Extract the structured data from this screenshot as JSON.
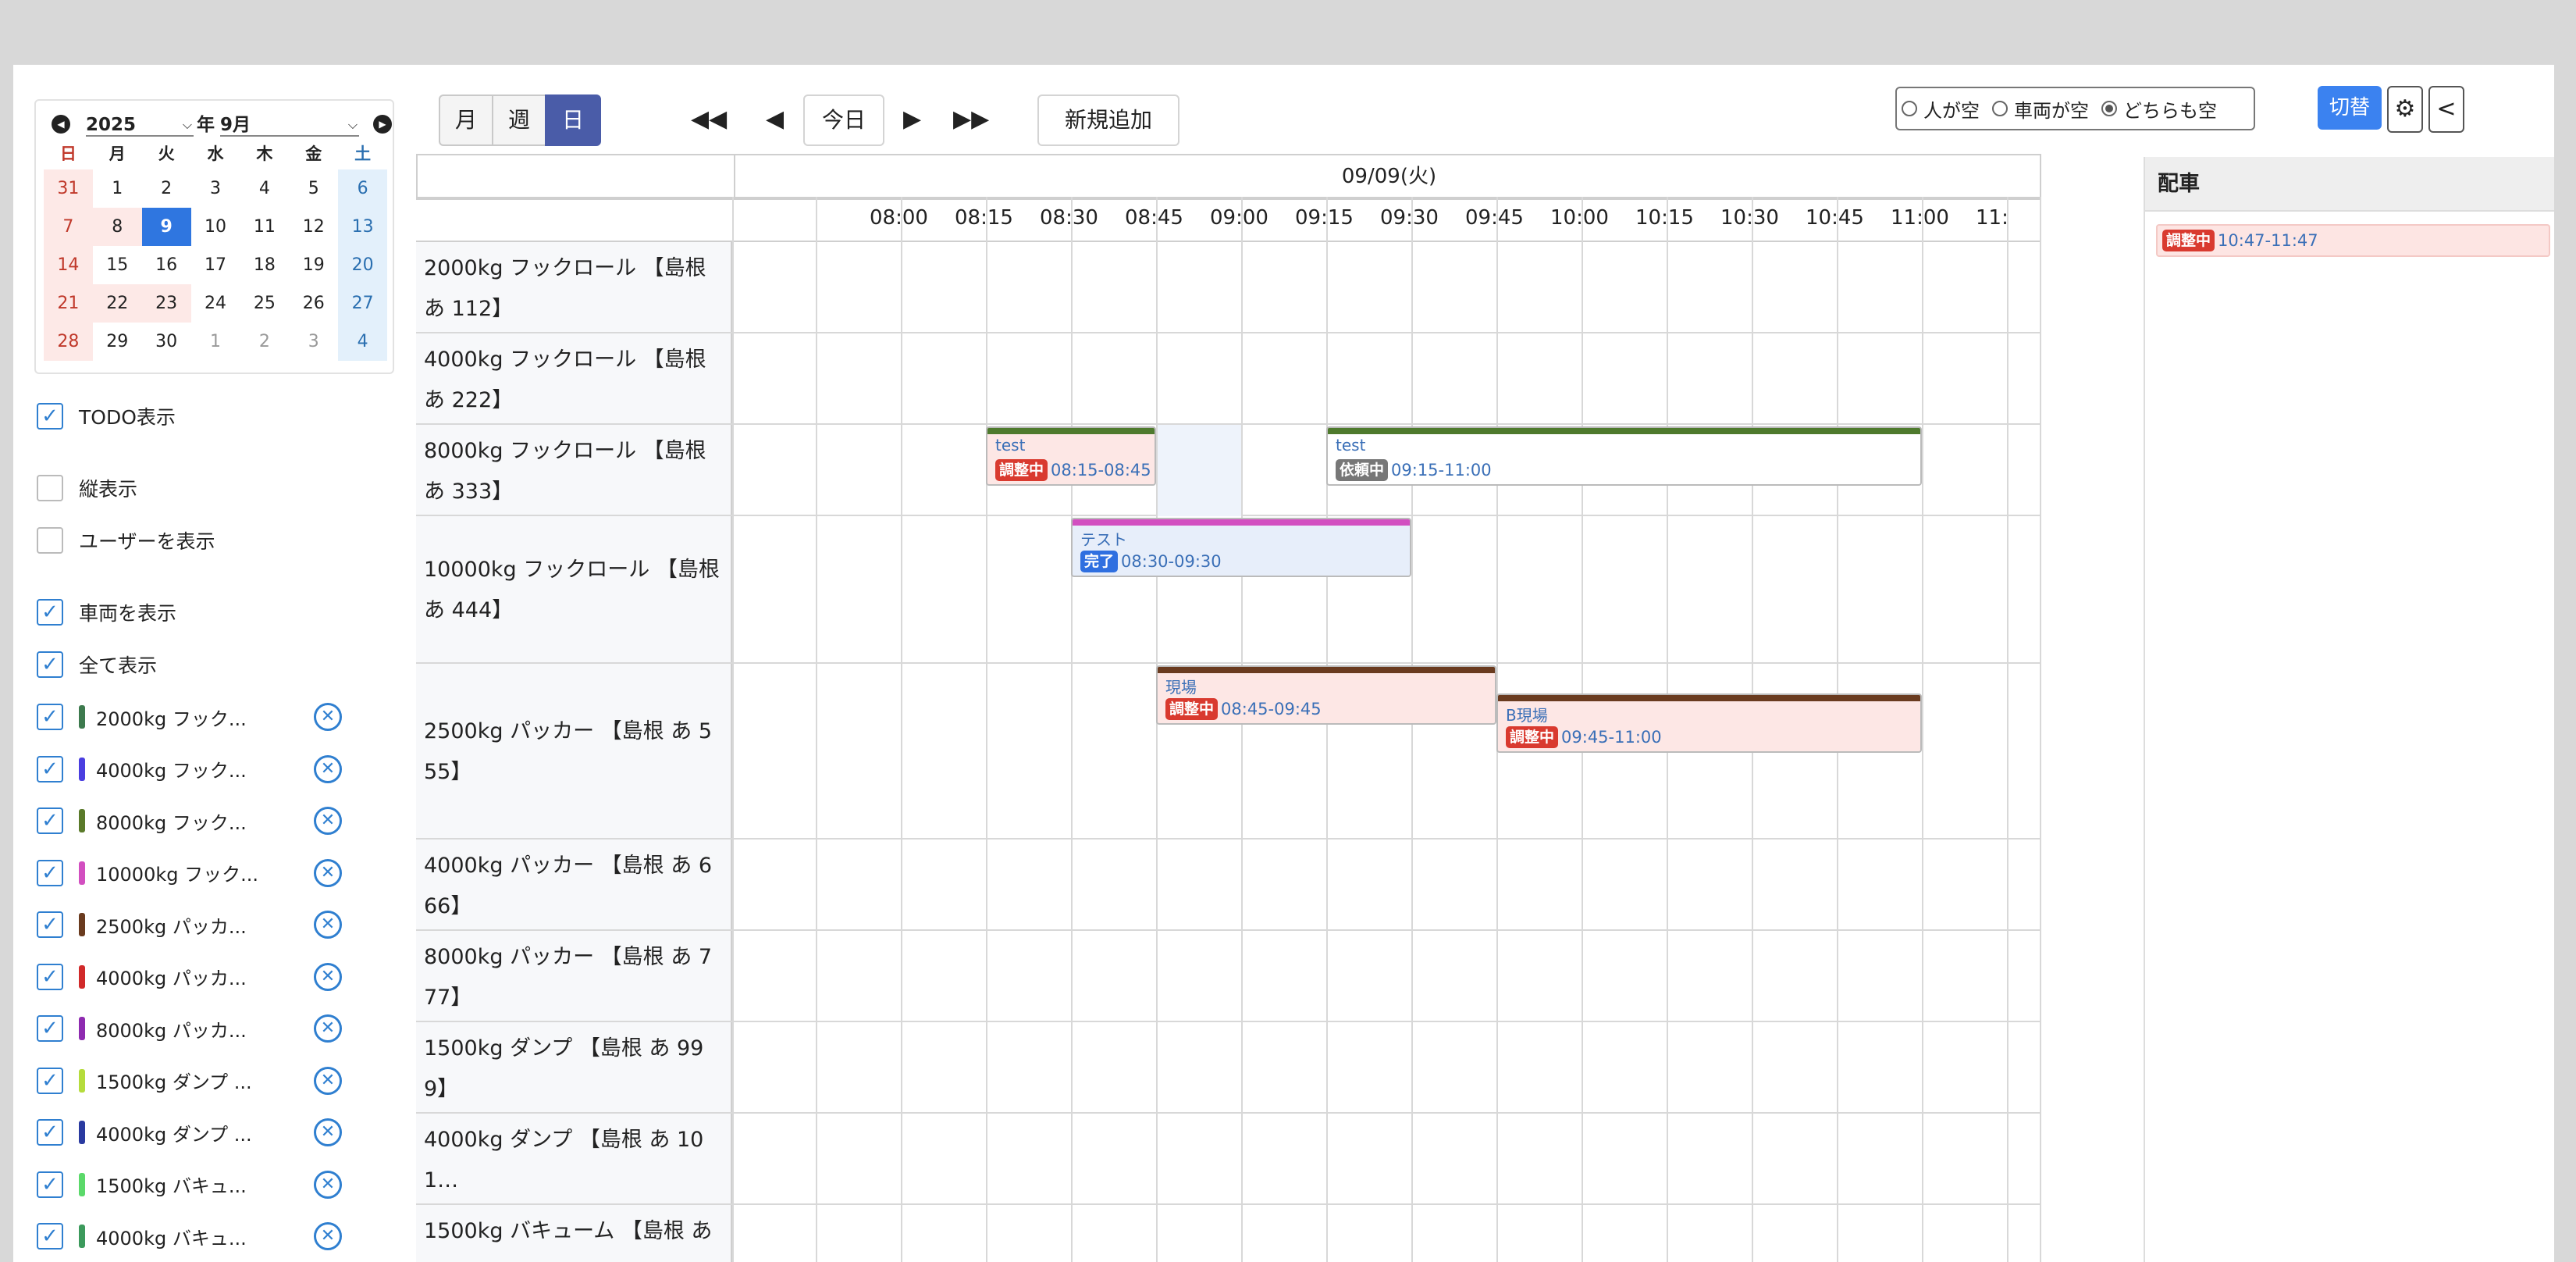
{
  "calendar": {
    "year": "2025",
    "month_suffix_label": "年",
    "month": "9月",
    "weekdays": [
      "日",
      "月",
      "火",
      "水",
      "木",
      "金",
      "土"
    ],
    "weeks": [
      [
        "31",
        "1",
        "2",
        "3",
        "4",
        "5",
        "6"
      ],
      [
        "7",
        "8",
        "9",
        "10",
        "11",
        "12",
        "13"
      ],
      [
        "14",
        "15",
        "16",
        "17",
        "18",
        "19",
        "20"
      ],
      [
        "21",
        "22",
        "23",
        "24",
        "25",
        "26",
        "27"
      ],
      [
        "28",
        "29",
        "30",
        "1",
        "2",
        "3",
        "4"
      ]
    ],
    "selected_day": "9"
  },
  "options": {
    "todo": "TODO表示",
    "vertical": "縦表示",
    "show_users": "ユーザーを表示",
    "show_vehicles": "車両を表示",
    "show_all": "全て表示"
  },
  "vehicle_filters": [
    {
      "label": "2000kg フック...",
      "color": "#3d7a4e"
    },
    {
      "label": "4000kg フック...",
      "color": "#4a3ee0"
    },
    {
      "label": "8000kg フック...",
      "color": "#5a7a2a"
    },
    {
      "label": "10000kg フック...",
      "color": "#d24fc0"
    },
    {
      "label": "2500kg パッカ...",
      "color": "#6a3b1f"
    },
    {
      "label": "4000kg パッカ...",
      "color": "#d12a2a"
    },
    {
      "label": "8000kg パッカ...",
      "color": "#8e2bb0"
    },
    {
      "label": "1500kg ダンプ ...",
      "color": "#b5dc3c"
    },
    {
      "label": "4000kg ダンプ ...",
      "color": "#2a3aa0"
    },
    {
      "label": "1500kg バキュ...",
      "color": "#5bd96a"
    },
    {
      "label": "4000kg バキュ...",
      "color": "#3c9a5c"
    }
  ],
  "toolbar": {
    "view_month": "月",
    "view_week": "週",
    "view_day": "日",
    "today": "今日",
    "new": "新規追加",
    "radio_person": "人が空",
    "radio_vehicle": "車両が空",
    "radio_both": "どちらも空",
    "switch": "切替",
    "gear_glyph": "⚙",
    "collapse_glyph": "<"
  },
  "schedule": {
    "date": "09/09(火)",
    "times": [
      "08:00",
      "08:15",
      "08:30",
      "08:45",
      "09:00",
      "09:15",
      "09:30",
      "09:45",
      "10:00",
      "10:15",
      "10:30",
      "10:45",
      "11:00",
      "11:"
    ],
    "rows": [
      "2000kg フックロール 【島根 あ 112】",
      "4000kg フックロール 【島根 あ 222】",
      "8000kg フックロール 【島根 あ 333】",
      "10000kg フックロール 【島根 あ 444】",
      "2500kg パッカー 【島根 あ 555】",
      "4000kg パッカー 【島根 あ 666】",
      "8000kg パッカー 【島根 あ 777】",
      "1500kg ダンプ 【島根 あ 999】",
      "4000kg ダンプ 【島根 あ 101…",
      "1500kg バキューム 【島根 あ"
    ],
    "events": [
      {
        "title": "test",
        "badge": "調整中",
        "time": "08:15-08:45",
        "bar_color": "#4e7a2d",
        "badge_color": "#d93a2f",
        "bg": "#fde7e5"
      },
      {
        "title": "test",
        "badge": "依頼中",
        "time": "09:15-11:00",
        "bar_color": "#4e7a2d",
        "badge_color": "#777777",
        "bg": "#ffffff"
      },
      {
        "title": "テスト",
        "badge": "完了",
        "time": "08:30-09:30",
        "bar_color": "#d24fc0",
        "badge_color": "#2f6fe0",
        "bg": "#e7eefa"
      },
      {
        "title": "現場",
        "badge": "調整中",
        "time": "08:45-09:45",
        "bar_color": "#6a3b1f",
        "badge_color": "#d93a2f",
        "bg": "#fde7e5"
      },
      {
        "title": "B現場",
        "badge": "調整中",
        "time": "09:45-11:00",
        "bar_color": "#6a3b1f",
        "badge_color": "#d93a2f",
        "bg": "#fde7e5"
      }
    ]
  },
  "right_panel": {
    "title": "配車",
    "item_badge": "調整中",
    "item_time": "10:47-11:47"
  }
}
